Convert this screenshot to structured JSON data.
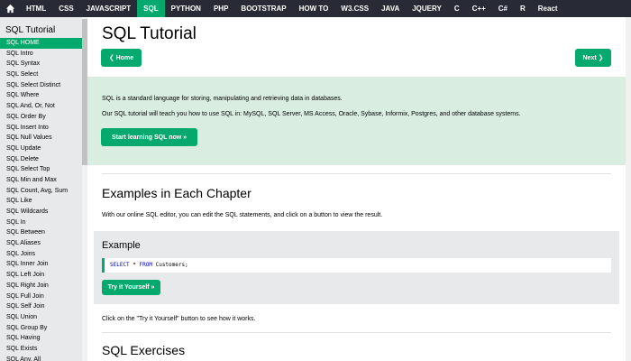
{
  "topnav": {
    "items": [
      {
        "label": "HTML",
        "active": false
      },
      {
        "label": "CSS",
        "active": false
      },
      {
        "label": "JAVASCRIPT",
        "active": false
      },
      {
        "label": "SQL",
        "active": true
      },
      {
        "label": "PYTHON",
        "active": false
      },
      {
        "label": "PHP",
        "active": false
      },
      {
        "label": "BOOTSTRAP",
        "active": false
      },
      {
        "label": "HOW TO",
        "active": false
      },
      {
        "label": "W3.CSS",
        "active": false
      },
      {
        "label": "JAVA",
        "active": false
      },
      {
        "label": "JQUERY",
        "active": false
      },
      {
        "label": "C",
        "active": false
      },
      {
        "label": "C++",
        "active": false
      },
      {
        "label": "C#",
        "active": false
      },
      {
        "label": "R",
        "active": false
      },
      {
        "label": "React",
        "active": false
      }
    ]
  },
  "sidebar": {
    "title": "SQL Tutorial",
    "items": [
      {
        "label": "SQL HOME",
        "active": true
      },
      {
        "label": "SQL Intro",
        "active": false
      },
      {
        "label": "SQL Syntax",
        "active": false
      },
      {
        "label": "SQL Select",
        "active": false
      },
      {
        "label": "SQL Select Distinct",
        "active": false
      },
      {
        "label": "SQL Where",
        "active": false
      },
      {
        "label": "SQL And, Or, Not",
        "active": false
      },
      {
        "label": "SQL Order By",
        "active": false
      },
      {
        "label": "SQL Insert Into",
        "active": false
      },
      {
        "label": "SQL Null Values",
        "active": false
      },
      {
        "label": "SQL Update",
        "active": false
      },
      {
        "label": "SQL Delete",
        "active": false
      },
      {
        "label": "SQL Select Top",
        "active": false
      },
      {
        "label": "SQL Min and Max",
        "active": false
      },
      {
        "label": "SQL Count, Avg, Sum",
        "active": false
      },
      {
        "label": "SQL Like",
        "active": false
      },
      {
        "label": "SQL Wildcards",
        "active": false
      },
      {
        "label": "SQL In",
        "active": false
      },
      {
        "label": "SQL Between",
        "active": false
      },
      {
        "label": "SQL Aliases",
        "active": false
      },
      {
        "label": "SQL Joins",
        "active": false
      },
      {
        "label": "SQL Inner Join",
        "active": false
      },
      {
        "label": "SQL Left Join",
        "active": false
      },
      {
        "label": "SQL Right Join",
        "active": false
      },
      {
        "label": "SQL Full Join",
        "active": false
      },
      {
        "label": "SQL Self Join",
        "active": false
      },
      {
        "label": "SQL Union",
        "active": false
      },
      {
        "label": "SQL Group By",
        "active": false
      },
      {
        "label": "SQL Having",
        "active": false
      },
      {
        "label": "SQL Exists",
        "active": false
      },
      {
        "label": "SQL Any, All",
        "active": false
      }
    ]
  },
  "main": {
    "title": "SQL Tutorial",
    "home_button": "❮ Home",
    "next_button": "Next ❯",
    "intro": {
      "p1": "SQL is a standard language for storing, manipulating and retrieving data in databases.",
      "p2": "Our SQL tutorial will teach you how to use SQL in: MySQL, SQL Server, MS Access, Oracle, Sybase, Informix, Postgres, and other database systems.",
      "button": "Start learning SQL now »"
    },
    "examples": {
      "heading": "Examples in Each Chapter",
      "description": "With our online SQL editor, you can edit the SQL statements, and click on a button to view the result.",
      "box_title": "Example",
      "code": {
        "kw1": "SELECT",
        "mid": " * ",
        "kw2": "FROM",
        "rest": " Customers;"
      },
      "try_button": "Try it Yourself »",
      "note": "Click on the \"Try it Yourself\" button to see how it works."
    },
    "exercises_heading": "SQL Exercises"
  },
  "colors": {
    "accent": "#04aa6d",
    "topnav_bg": "#282a35",
    "sidebar_bg": "#e7e9eb",
    "intro_bg": "#d9eee1",
    "keyword": "#0000cd"
  }
}
